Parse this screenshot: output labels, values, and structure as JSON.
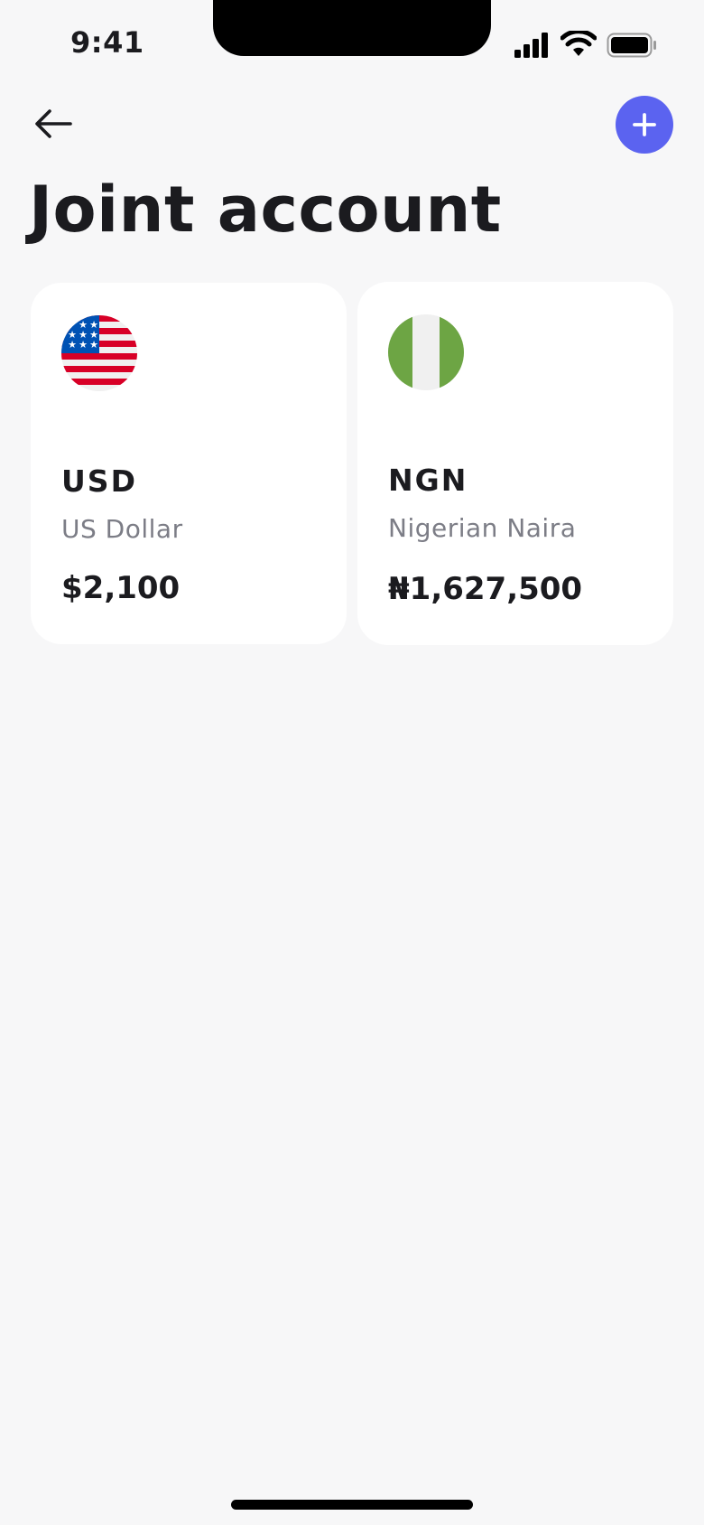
{
  "status_bar": {
    "time": "9:41",
    "icons": [
      "signal-icon",
      "wifi-icon",
      "battery-icon"
    ]
  },
  "header": {
    "back_icon": "arrow-left-icon",
    "add_icon": "plus-icon",
    "title": "Joint account"
  },
  "accounts": [
    {
      "code": "USD",
      "name": "US Dollar",
      "balance": "$2,100",
      "flag_icon": "us-flag-icon"
    },
    {
      "code": "NGN",
      "name": "Nigerian Naira",
      "balance": "₦1,627,500",
      "flag_icon": "nigeria-flag-icon"
    }
  ],
  "colors": {
    "background": "#f7f7f8",
    "card": "#ffffff",
    "accent": "#5b63f0",
    "text_primary": "#1b1b1f",
    "text_secondary": "#7c7d86",
    "us_red": "#d80027",
    "us_blue": "#0052b4",
    "ng_green": "#6da544",
    "ng_white": "#f0f0f0"
  }
}
